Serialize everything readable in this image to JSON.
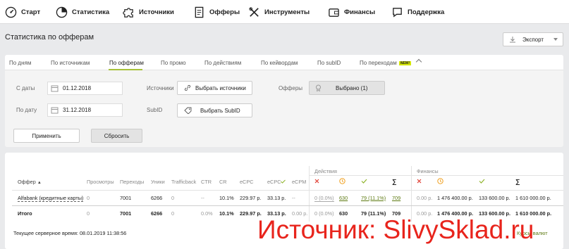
{
  "nav": {
    "start": "Старт",
    "stats": "Статистика",
    "sources": "Источники",
    "offers": "Офферы",
    "tools": "Инструменты",
    "finance": "Финансы",
    "support": "Поддержка"
  },
  "page": {
    "title": "Статистика по офферам",
    "export_label": "Экспорт"
  },
  "tabs": {
    "days": "По дням",
    "sources": "По источникам",
    "offers": "По офферам",
    "promo": "По промо",
    "actions": "По действиям",
    "keywords": "По кейвордам",
    "subid": "По subID",
    "clicks": "По переходам",
    "new_badge": "NEW!"
  },
  "filters": {
    "from_label": "С даты",
    "from_value": "01.12.2018",
    "to_label": "По дату",
    "to_value": "31.12.2018",
    "sources_label": "Источники",
    "sources_button": "Выбрать источники",
    "subid_label": "SubID",
    "subid_button": "Выбрать SubID",
    "offers_label": "Офферы",
    "offers_button": "Выбрано (1)",
    "apply": "Применить",
    "reset": "Сбросить"
  },
  "table": {
    "group_actions": "Действия",
    "group_finance": "Финансы",
    "headers": {
      "offer": "Оффер",
      "views": "Просмотры",
      "clicks": "Переходы",
      "uniques": "Уники",
      "trafficback": "Trafficback",
      "ctr": "CTR",
      "cr": "CR",
      "ecpc": "eCPC",
      "ecpc2": "eCPC",
      "ecpm": "eCPM",
      "sigma": "∑"
    },
    "row": {
      "offer": "Alfabank (кредитные карты)",
      "views": "0",
      "clicks": "7001",
      "uniques": "6266",
      "trafficback": "0",
      "ctr": "--",
      "cr": "10.1%",
      "ecpc": "229.97 р.",
      "ecpc2": "33.13 р.",
      "ecpm": "--",
      "act_rejected": "0 (0.0%)",
      "act_pending": "630",
      "act_approved": "79 (11.1%)",
      "act_total": "709",
      "fin_rejected": "0.00 р.",
      "fin_pending": "1 476 400.00 р.",
      "fin_approved": "133 600.00 р.",
      "fin_total": "1 610 000.00 р."
    },
    "total": {
      "label": "Итого",
      "views": "0",
      "clicks": "7001",
      "uniques": "6266",
      "trafficback": "0",
      "ctr": "0.0%",
      "cr": "10.1%",
      "ecpc": "229.97 р.",
      "ecpc2": "33.13 р.",
      "ecpm": "0.00 р.",
      "act_rejected": "0 (0.0%)",
      "act_pending": "630",
      "act_approved": "79 (11.1%)",
      "act_total": "709",
      "fin_rejected": "0.00 р.",
      "fin_pending": "1 476 400.00 р.",
      "fin_approved": "133 600.00 р.",
      "fin_total": "1 610 000.00 р."
    },
    "server_time": "Текущее серверное время: 08.01.2019 11:38:56",
    "rates_link": "Курсы валют"
  },
  "watermark": "Источник: SlivySklad.ru",
  "colors": {
    "accent_green": "#a7c13a",
    "reject_red": "#e03c31",
    "pending_orange": "#f0a020",
    "approve_green": "#8fb32a",
    "watermark_red": "#e8241c"
  },
  "icons": {
    "start": "speedometer-icon",
    "stats": "pie-chart-icon",
    "sources": "puzzle-icon",
    "offers": "document-icon",
    "tools": "tools-icon",
    "finance": "wallet-icon",
    "support": "chat-bubble-icon"
  }
}
